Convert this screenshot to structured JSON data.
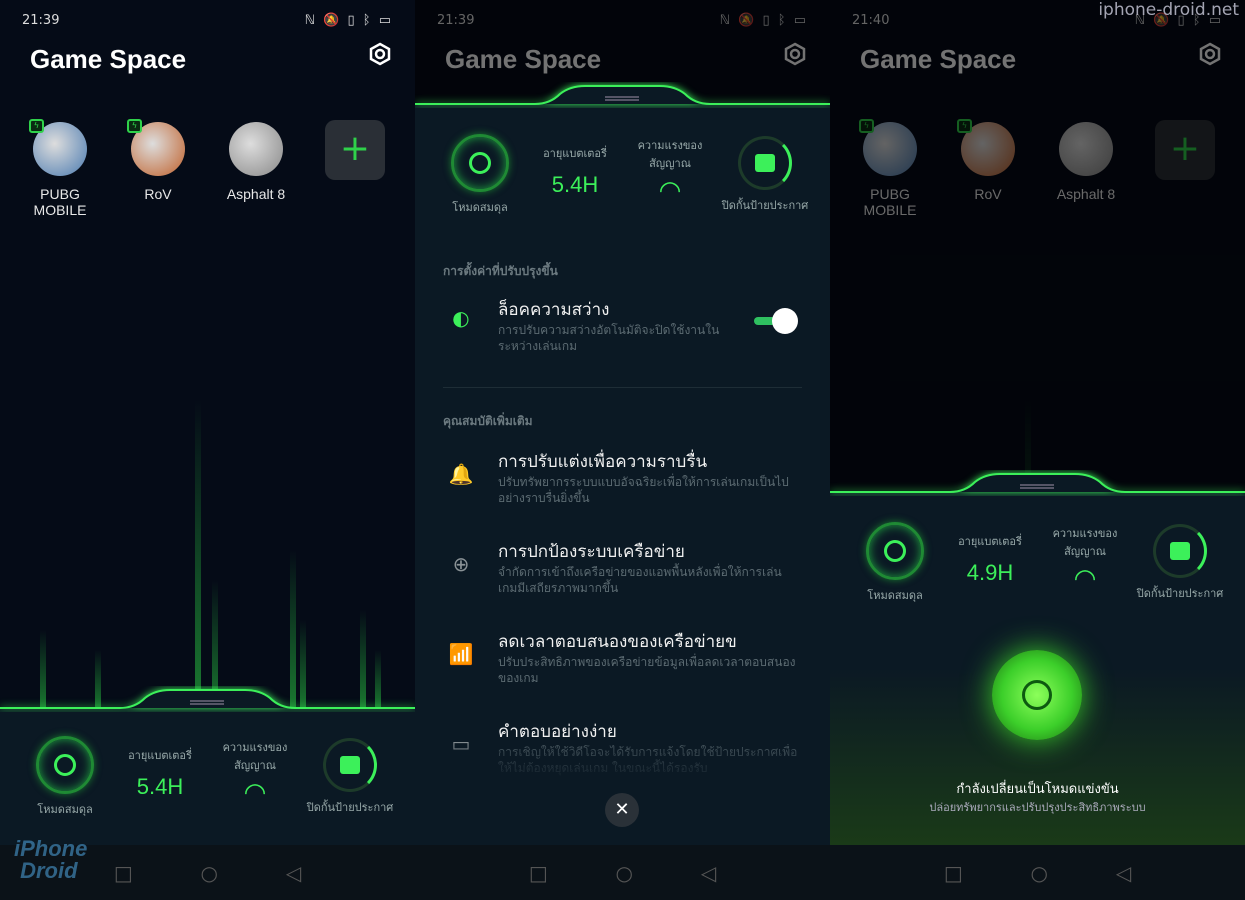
{
  "accent": "#3cf05a",
  "watermark": "iphone-droid.net",
  "logo_text": "iPhone Droid",
  "app_title": "Game Space",
  "games": [
    {
      "name": "PUBG MOBILE",
      "boost": true,
      "color": "#4a7ab0"
    },
    {
      "name": "RoV",
      "boost": true,
      "color": "#c0602a"
    },
    {
      "name": "Asphalt 8",
      "boost": false,
      "color": "#888"
    }
  ],
  "add_label": "+",
  "stats_labels": {
    "mode": "โหมดสมดุล",
    "battery": "อายุแบตเตอรี่",
    "signal": "ความแรงของสัญญาณ",
    "block": "ปิดกั้นป้ายประกาศ"
  },
  "panels": [
    {
      "time": "21:39",
      "battery_value": "5.4H"
    },
    {
      "time": "21:39",
      "battery_value": "5.4H"
    },
    {
      "time": "21:40",
      "battery_value": "4.9H"
    }
  ],
  "status_icons": "ℕ 🔕 ▯ ᛒ ▭",
  "settings": {
    "section1": "การตั้งค่าที่ปรับปรุงขึ้น",
    "brightness": {
      "title": "ล็อคความสว่าง",
      "desc": "การปรับความสว่างอัตโนมัติจะปิดใช้งานในระหว่างเล่นเกม",
      "on": true
    },
    "section2": "คุณสมบัติเพิ่มเติม",
    "items": [
      {
        "icon": "bell-icon",
        "glyph": "🔔",
        "title": "การปรับแต่งเพื่อความราบรื่น",
        "desc": "ปรับทรัพยากรระบบแบบอัจฉริยะเพื่อให้การเล่นเกมเป็นไปอย่างราบรื่นยิ่งขึ้น"
      },
      {
        "icon": "globe-icon",
        "glyph": "⊕",
        "title": "การปกป้องระบบเครือข่าย",
        "desc": "จำกัดการเข้าถึงเครือข่ายของแอพพื้นหลังเพื่อให้การเล่นเกมมีเสถียรภาพมากขึ้น"
      },
      {
        "icon": "signal-boost-icon",
        "glyph": "📶",
        "title": "ลดเวลาตอบสนองของเครือข่ายข",
        "desc": "ปรับประสิทธิภาพของเครือข่ายข้อมูลเพื่อลดเวลาตอบสนองของเกม"
      },
      {
        "icon": "video-call-icon",
        "glyph": "▭",
        "title": "คำตอบอย่างง่าย",
        "desc": "การเชิญให้ใช้วิดีโอจะได้รับการแจ้งโดยใช้ป้ายประกาศเพื่อให้ไม่ต้องหยุดเล่นเกม ในขณะนี้ได้รองรับ"
      }
    ],
    "close": "✕"
  },
  "switching": {
    "title": "กำลังเปลี่ยนเป็นโหมดแข่งขัน",
    "subtitle": "ปล่อยทรัพยากรและปรับปรุงประสิทธิภาพระบบ"
  },
  "nav": {
    "recent": "□",
    "home": "○",
    "back": "◁"
  }
}
